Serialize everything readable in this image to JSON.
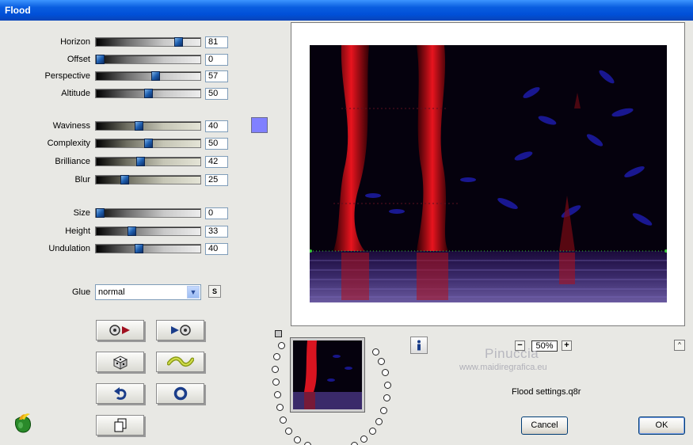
{
  "window": {
    "title": "Flood"
  },
  "sliders": [
    {
      "label": "Horizon",
      "value": "81",
      "fraction": 0.81,
      "style": "gray"
    },
    {
      "label": "Offset",
      "value": "0",
      "fraction": 0.0,
      "style": "gray"
    },
    {
      "label": "Perspective",
      "value": "57",
      "fraction": 0.57,
      "style": "gray"
    },
    {
      "label": "Altitude",
      "value": "50",
      "fraction": 0.5,
      "style": "gray"
    },
    {
      "label": "Waviness",
      "value": "40",
      "fraction": 0.4,
      "style": "green"
    },
    {
      "label": "Complexity",
      "value": "50",
      "fraction": 0.5,
      "style": "green"
    },
    {
      "label": "Brilliance",
      "value": "42",
      "fraction": 0.42,
      "style": "green"
    },
    {
      "label": "Blur",
      "value": "25",
      "fraction": 0.25,
      "style": "green"
    },
    {
      "label": "Size",
      "value": "0",
      "fraction": 0.0,
      "style": "gray"
    },
    {
      "label": "Height",
      "value": "33",
      "fraction": 0.33,
      "style": "gray"
    },
    {
      "label": "Undulation",
      "value": "40",
      "fraction": 0.4,
      "style": "gray"
    }
  ],
  "color": {
    "swatch": "#8080ff"
  },
  "glue": {
    "label": "Glue",
    "value": "normal",
    "s_label": "S"
  },
  "toolbar_icons": [
    "play-reverse-icon",
    "play-forward-icon",
    "dice-icon",
    "wave-icon",
    "undo-icon",
    "reset-icon",
    "copy-icon"
  ],
  "zoom": {
    "value": "50%",
    "minus": "−",
    "plus": "+",
    "collapse": "^"
  },
  "watermark": {
    "line1": "Pinuccia",
    "line2": "www.maidiregrafica.eu"
  },
  "settings_file": "Flood settings.q8r",
  "buttons": {
    "cancel": "Cancel",
    "ok": "OK"
  }
}
